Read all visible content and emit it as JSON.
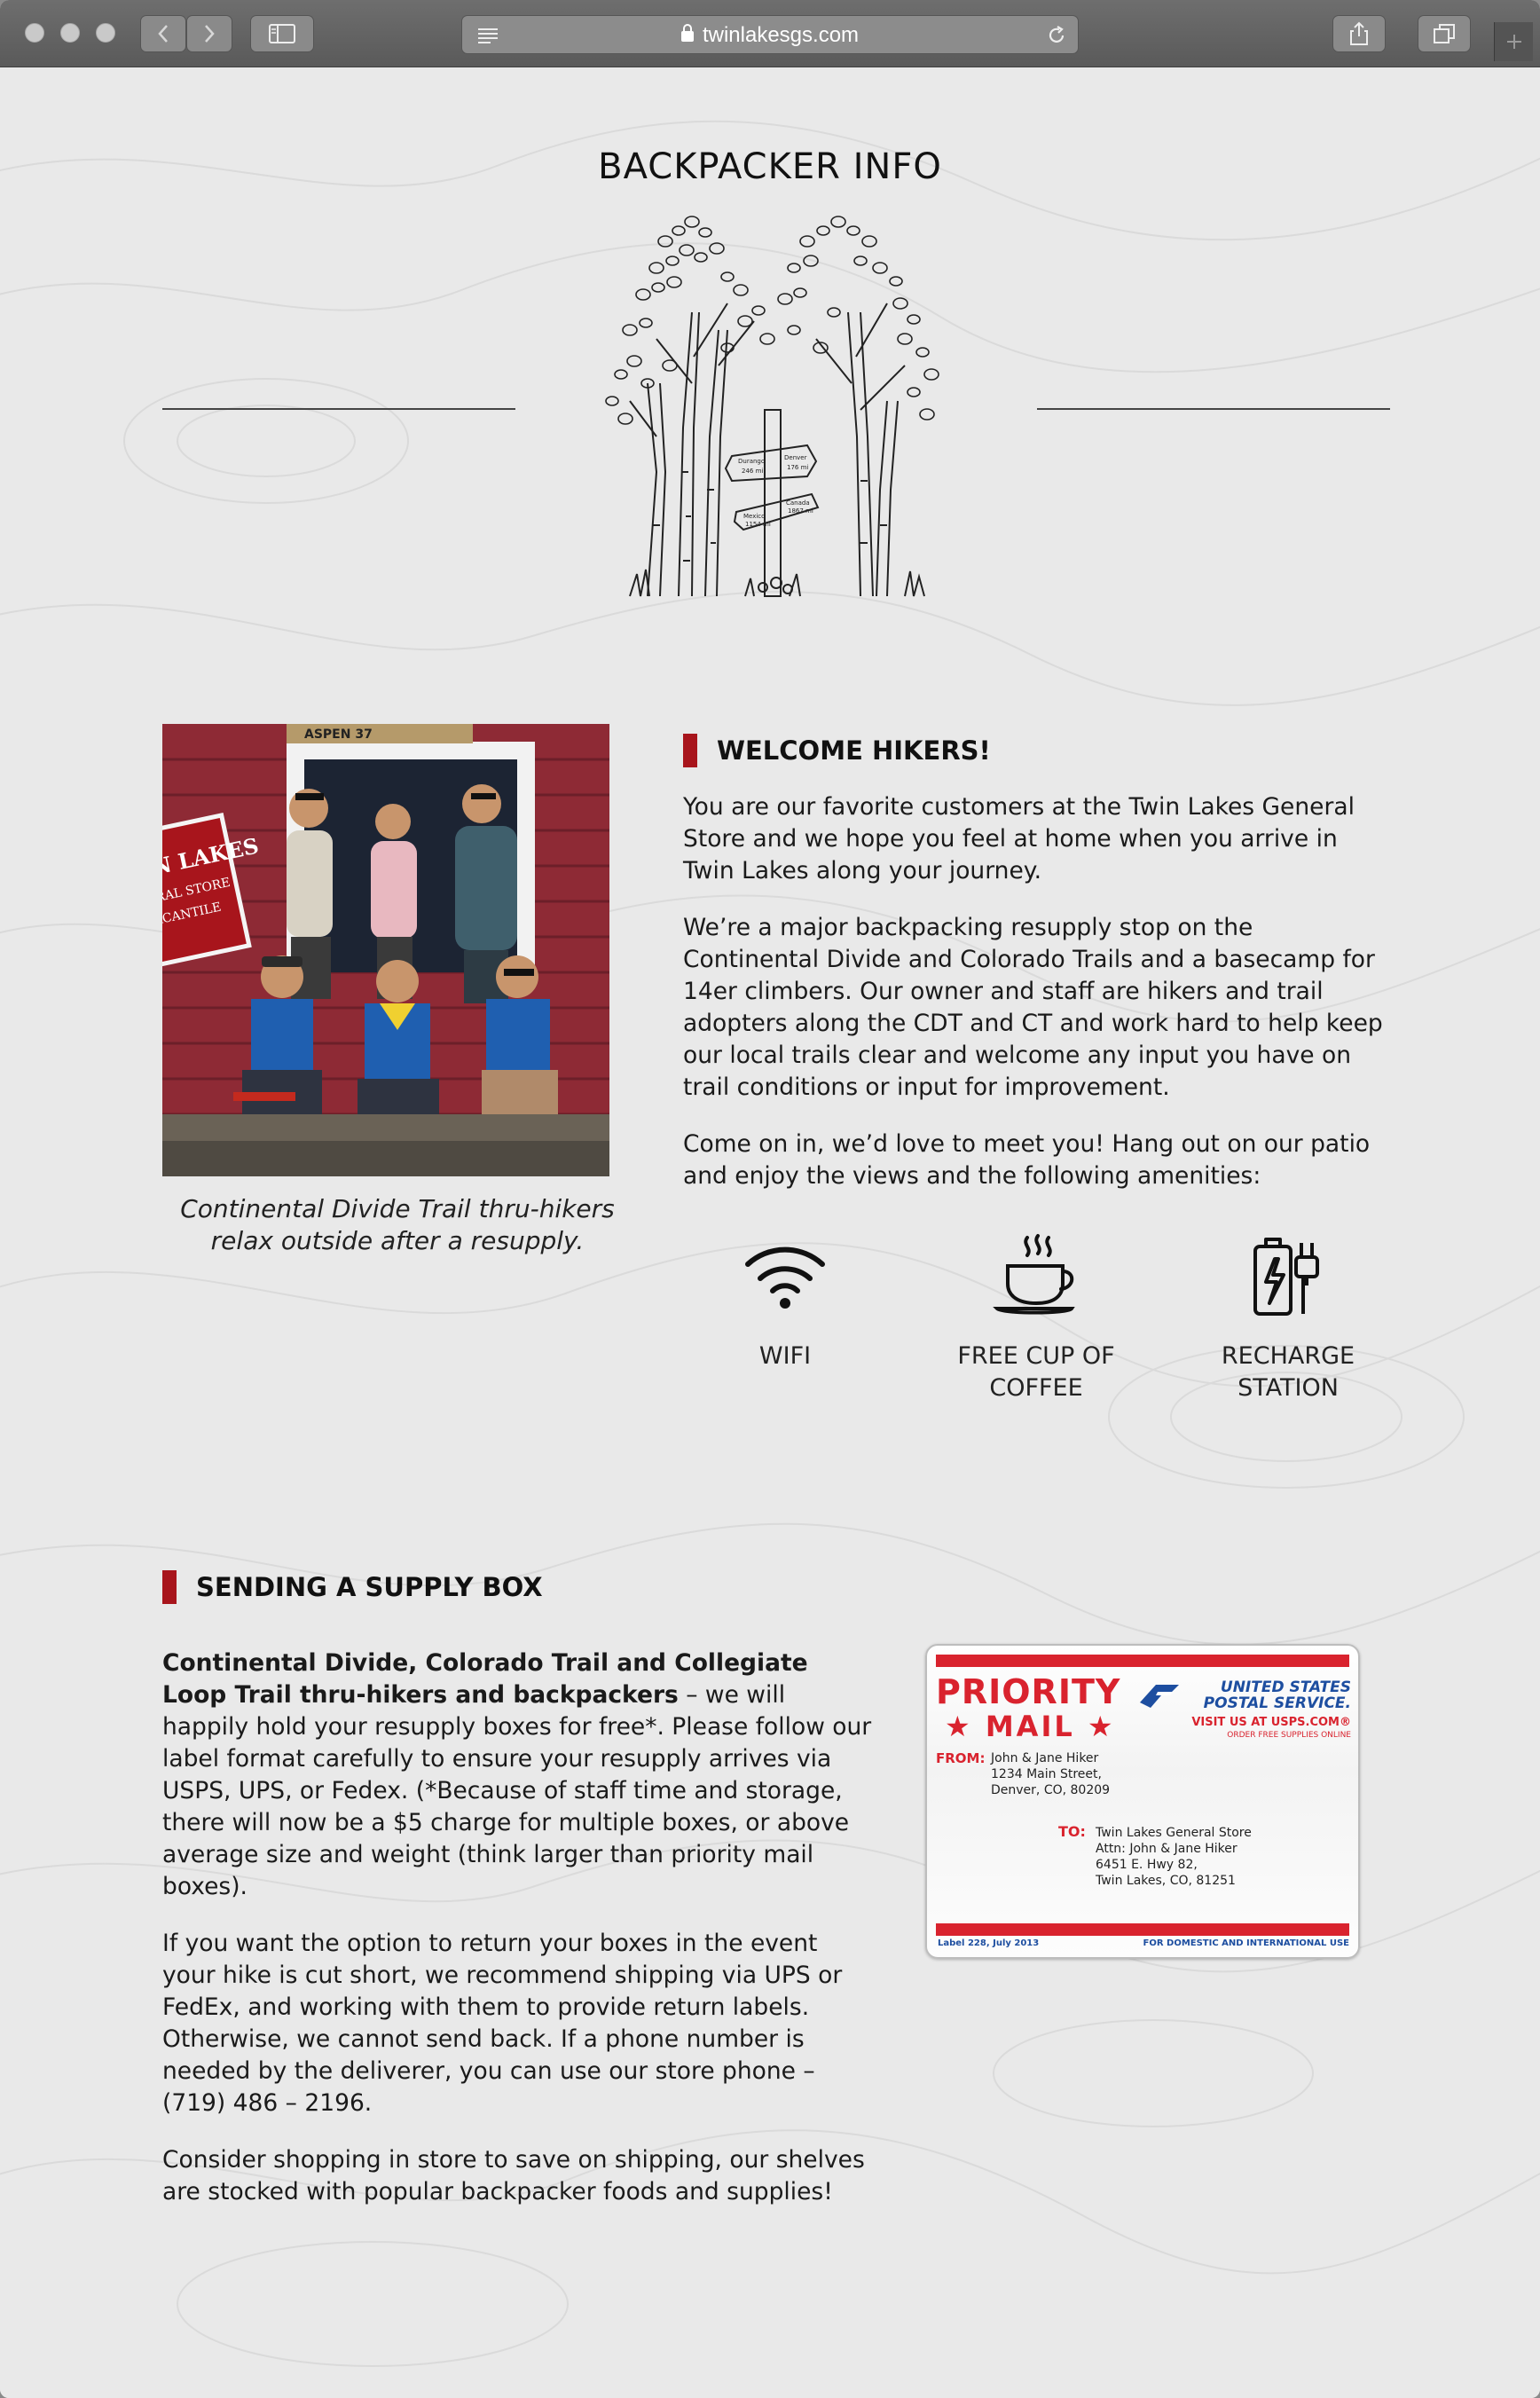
{
  "browser": {
    "url": "twinlakesgs.com"
  },
  "page": {
    "title": "BACKPACKER INFO",
    "photo_caption": "Continental Divide Trail thru-hikers relax outside after a resupply.",
    "photo_sign": {
      "store_line1": "IN LAKES",
      "store_line2": "ERAL STORE",
      "store_line3": "RCANTILE",
      "aspen": "ASPEN 37"
    },
    "trail_sign": {
      "left_top": "Durango",
      "left_top_dist": "246 mi",
      "right_top": "Denver",
      "right_top_dist": "176 mi",
      "left_bottom": "Mexico",
      "left_bottom_dist": "1154 mi",
      "right_bottom": "Canada",
      "right_bottom_dist": "1867 mi"
    }
  },
  "welcome": {
    "heading": "WELCOME HIKERS!",
    "p1": "You are our favorite customers at the Twin Lakes General Store and we hope you feel at home when you arrive in Twin Lakes along your journey.",
    "p2": "We’re a major backpacking resupply stop on the Continental Divide and Colorado Trails and a basecamp for 14er climbers. Our owner and staff are hikers and trail adopters along the CDT and CT and work hard to help keep our local trails clear and welcome any input you have on trail conditions or input for improvement.",
    "p3": "Come on in, we’d love to meet you! Hang out on our patio and enjoy the views and the following amenities:"
  },
  "amenities": [
    {
      "icon": "wifi-icon",
      "label": "WIFI"
    },
    {
      "icon": "coffee-cup-icon",
      "label": "FREE CUP OF COFFEE"
    },
    {
      "icon": "charging-station-icon",
      "label": "RECHARGE STATION"
    }
  ],
  "supply": {
    "heading": "SENDING A SUPPLY BOX",
    "p1_bold": "Continental Divide, Colorado Trail and Collegiate Loop Trail thru-hikers and backpackers",
    "p1_rest": " – we will happily hold your resupply boxes for free*. Please follow our label format carefully to ensure your resupply arrives via USPS, UPS, or Fedex. (*Because of staff time and storage, there will now be a $5 charge for multiple boxes, or above average size and weight (think larger than priority mail boxes).",
    "p2": "If you want the option to return your boxes in the event your hike is cut short, we recommend shipping via UPS or FedEx, and working with them to provide return labels. Otherwise, we cannot send back. If a phone number is needed by the deliverer, you can use our store phone – (719) 486 – 2196.",
    "p3": "Consider shopping in store to save on shipping, our shelves are stocked with popular backpacker foods and supplies!"
  },
  "mail_label": {
    "priority": "PRIORITY",
    "mail": "★ MAIL ★",
    "usps_line1": "UNITED STATES",
    "usps_line2": "POSTAL SERVICE.",
    "visit": "VISIT US AT USPS.COM®",
    "visit_small": "ORDER FREE SUPPLIES ONLINE",
    "from_label": "FROM:",
    "from_line1": "John & Jane Hiker",
    "from_line2": "1234 Main Street,",
    "from_line3": "Denver, CO,  80209",
    "to_label": "TO:",
    "to_line1": "Twin Lakes General Store",
    "to_line2": "Attn: John & Jane Hiker",
    "to_line3": "6451 E. Hwy 82,",
    "to_line4": "Twin Lakes, CO, 81251",
    "footer_left": "Label 228, July 2013",
    "footer_right": "FOR DOMESTIC AND INTERNATIONAL USE"
  },
  "colors": {
    "accent_red": "#a8151c",
    "usps_red": "#d9232e",
    "usps_blue": "#1d4ea0",
    "page_bg": "#e9e9e9"
  }
}
